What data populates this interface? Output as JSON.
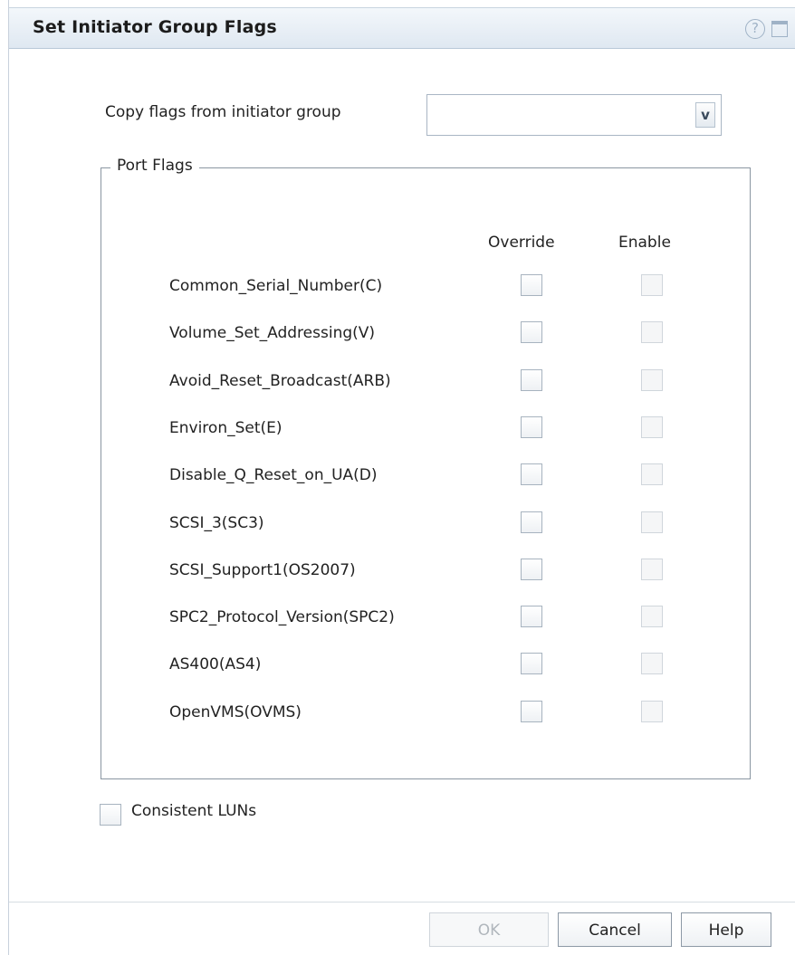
{
  "dialog": {
    "title": "Set Initiator Group Flags",
    "help_glyph": "?",
    "icons": [
      "help-icon",
      "maximize-icon",
      "chevron-down-icon"
    ]
  },
  "copy_flags": {
    "label": "Copy flags from initiator group",
    "selected_value": "",
    "dropdown_glyph": "v"
  },
  "port_flags": {
    "legend": "Port Flags",
    "override_header": "Override",
    "enable_header": "Enable",
    "flags": [
      {
        "label": "Common_Serial_Number(C)",
        "override": false,
        "enable": false
      },
      {
        "label": "Volume_Set_Addressing(V)",
        "override": false,
        "enable": false
      },
      {
        "label": "Avoid_Reset_Broadcast(ARB)",
        "override": false,
        "enable": false
      },
      {
        "label": "Environ_Set(E)",
        "override": false,
        "enable": false
      },
      {
        "label": "Disable_Q_Reset_on_UA(D)",
        "override": false,
        "enable": false
      },
      {
        "label": "SCSI_3(SC3)",
        "override": false,
        "enable": false
      },
      {
        "label": "SCSI_Support1(OS2007)",
        "override": false,
        "enable": false
      },
      {
        "label": "SPC2_Protocol_Version(SPC2)",
        "override": false,
        "enable": false
      },
      {
        "label": "AS400(AS4)",
        "override": false,
        "enable": false
      },
      {
        "label": "OpenVMS(OVMS)",
        "override": false,
        "enable": false
      }
    ]
  },
  "consistent_luns": {
    "label": "Consistent LUNs",
    "checked": false
  },
  "buttons": {
    "ok": "OK",
    "ok_enabled": false,
    "cancel": "Cancel",
    "help": "Help"
  }
}
